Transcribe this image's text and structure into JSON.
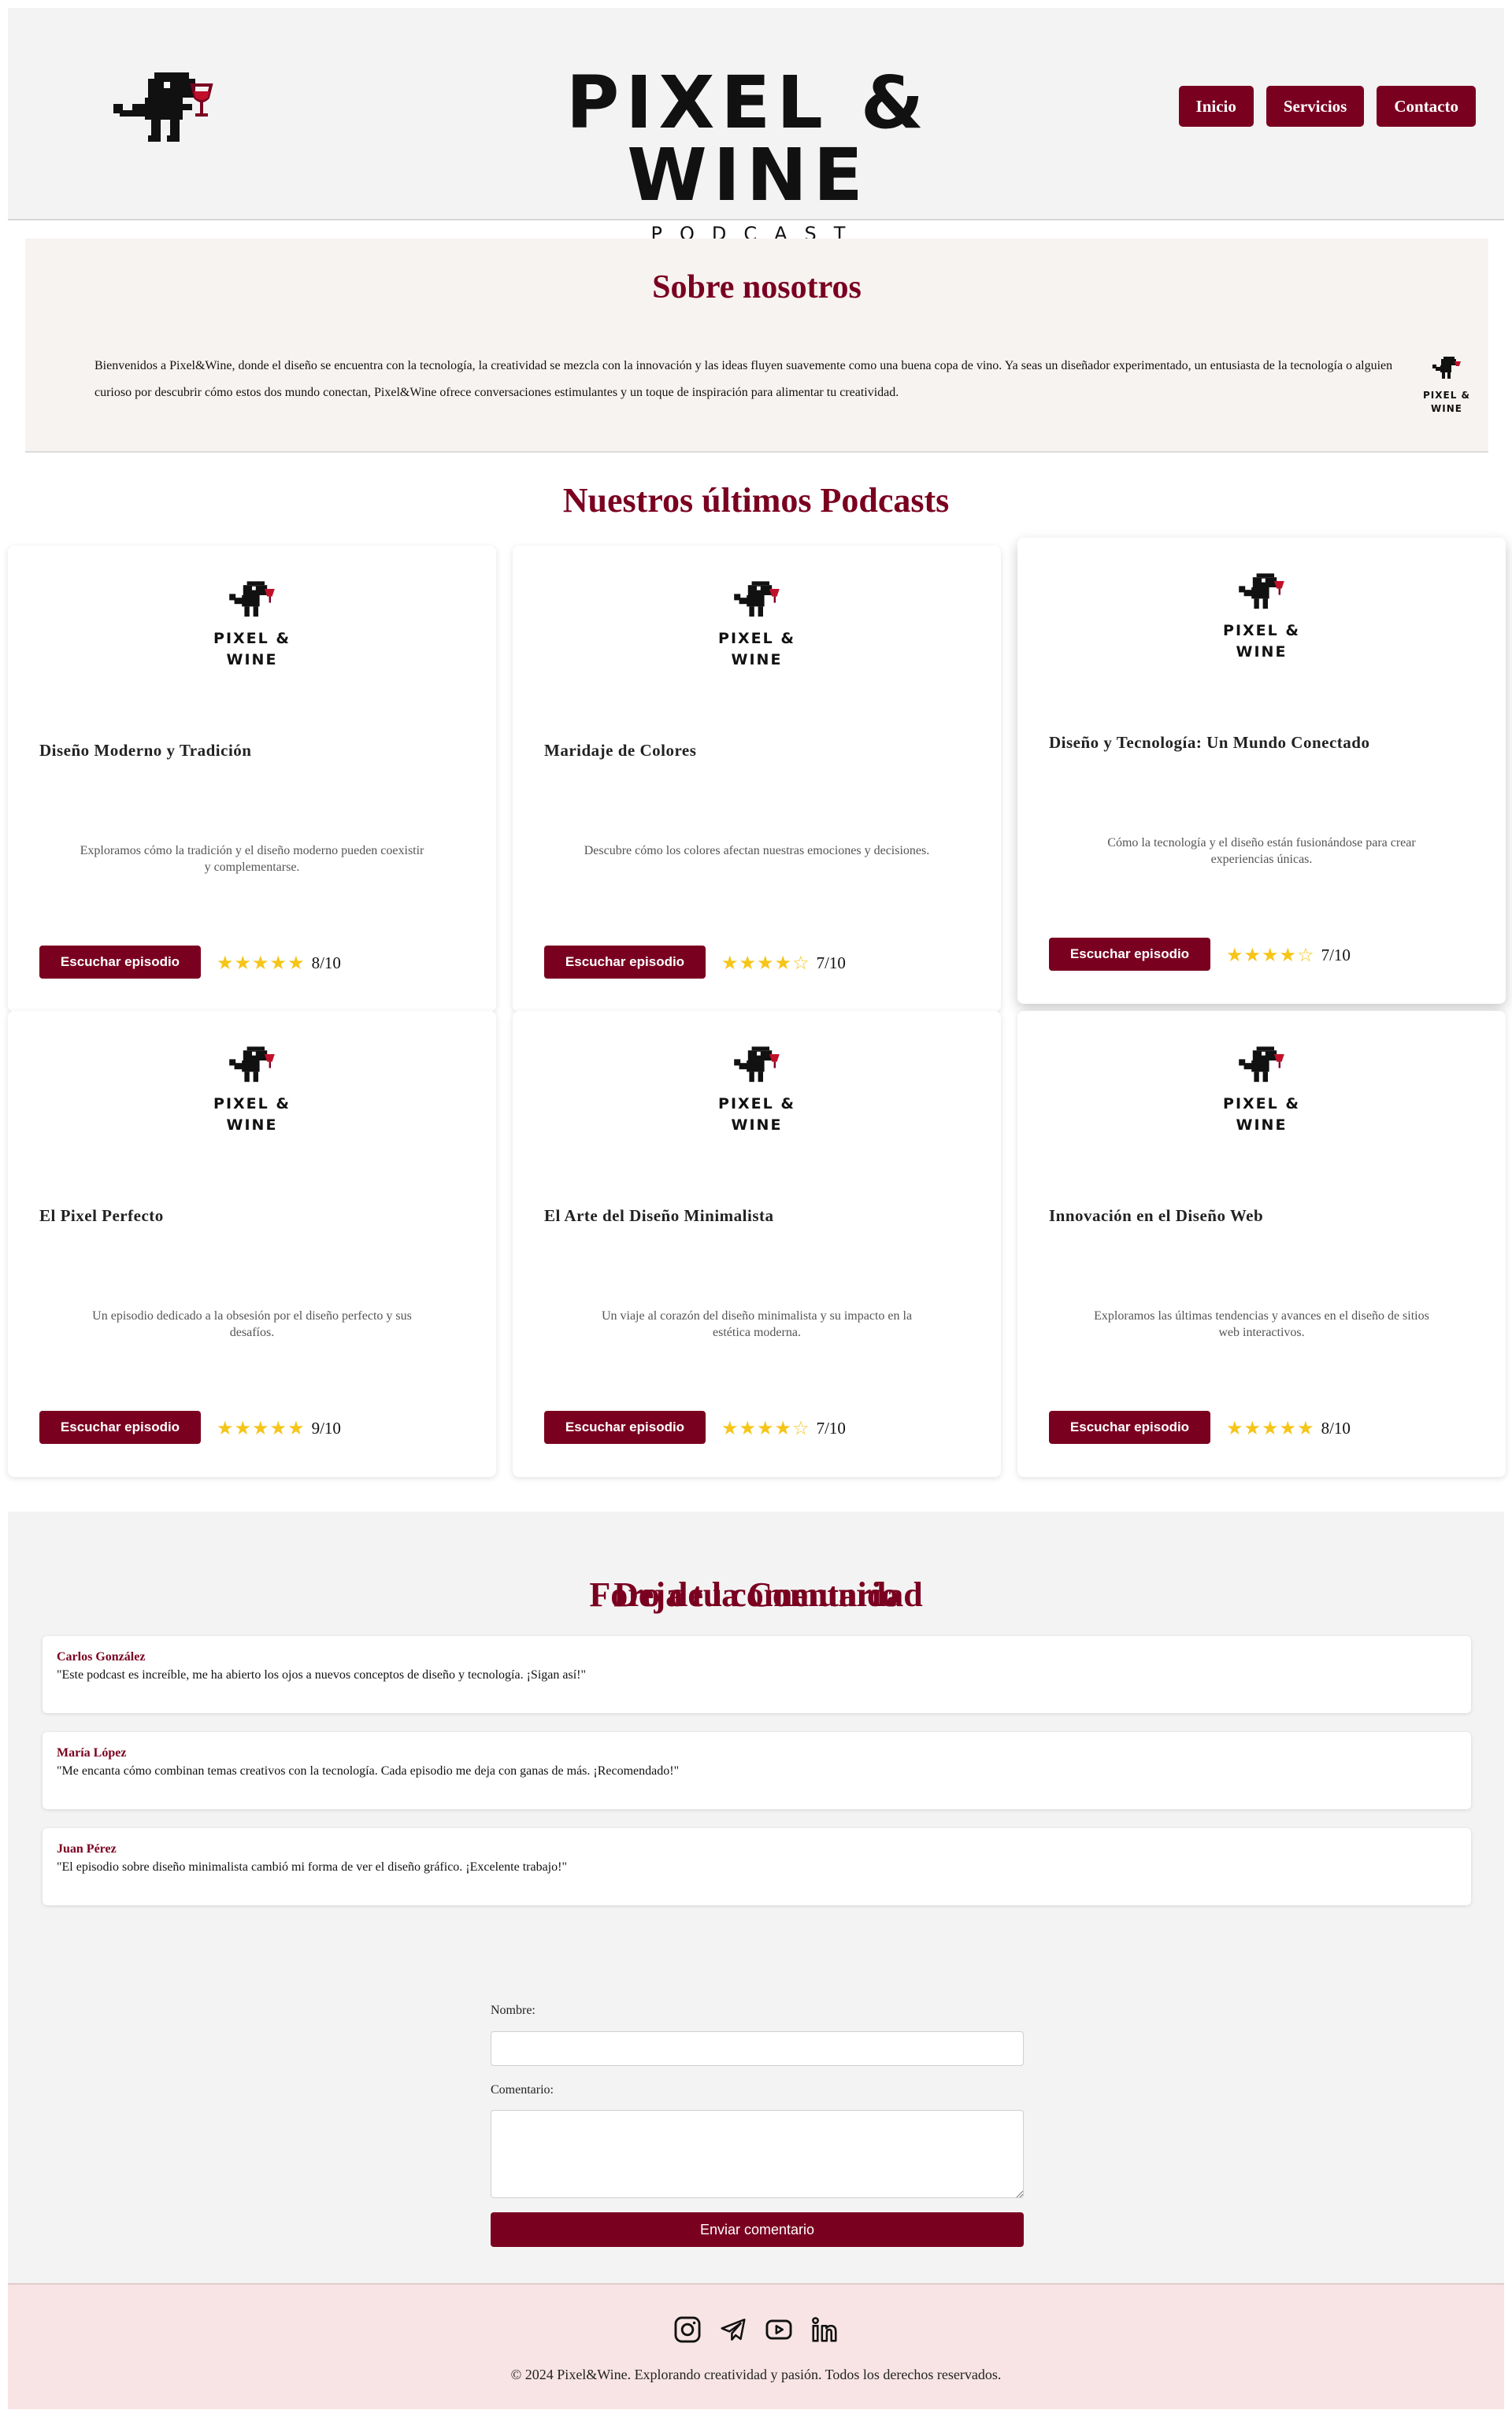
{
  "header": {
    "brand_name": "PIXEL & WINE",
    "brand_sub": "PODCAST",
    "nav": [
      "Inicio",
      "Servicios",
      "Contacto"
    ]
  },
  "about": {
    "title": "Sobre nosotros",
    "text": "Bienvenidos a Pixel&Wine, donde el diseño se encuentra con la tecnología, la creatividad se mezcla con la innovación y las ideas fluyen suavemente como una buena copa de vino. Ya seas un diseñador experimentado, un entusiasta de la tecnología o alguien curioso por descubrir cómo estos dos mundo conectan, Pixel&Wine ofrece conversaciones estimulantes y un toque de inspiración para alimentar tu creatividad."
  },
  "podcasts": {
    "title": "Nuestros últimos Podcasts",
    "logo_line1": "PIXEL &",
    "logo_line2": "WINE",
    "button_label": "Escuchar episodio",
    "items": [
      {
        "title": "Diseño Moderno y Tradición",
        "desc": "Exploramos cómo la tradición y el diseño moderno pueden coexistir y complementarse.",
        "stars": "★★★★★",
        "score": "8/10"
      },
      {
        "title": "Maridaje de Colores",
        "desc": "Descubre cómo los colores afectan nuestras emociones y decisiones.",
        "stars": "★★★★☆",
        "score": "7/10"
      },
      {
        "title": "Diseño y Tecnología: Un Mundo Conectado",
        "desc": "Cómo la tecnología y el diseño están fusionándose para crear experiencias únicas.",
        "stars": "★★★★☆",
        "score": "7/10"
      },
      {
        "title": "El Pixel Perfecto",
        "desc": "Un episodio dedicado a la obsesión por el diseño perfecto y sus desafíos.",
        "stars": "★★★★★",
        "score": "9/10"
      },
      {
        "title": "El Arte del Diseño Minimalista",
        "desc": "Un viaje al corazón del diseño minimalista y su impacto en la estética moderna.",
        "stars": "★★★★☆",
        "score": "7/10"
      },
      {
        "title": "Innovación en el Diseño Web",
        "desc": "Exploramos las últimas tendencias y avances en el diseño de sitios web interactivos.",
        "stars": "★★★★★",
        "score": "8/10"
      }
    ]
  },
  "forum": {
    "title": "Foro de la Comunidad",
    "comments": [
      {
        "author": "Carlos González",
        "text": "\"Este podcast es increíble, me ha abierto los ojos a nuevos conceptos de diseño y tecnología. ¡Sigan así!\""
      },
      {
        "author": "María López",
        "text": "\"Me encanta cómo combinan temas creativos con la tecnología. Cada episodio me deja con ganas de más. ¡Recomendado!\""
      },
      {
        "author": "Juan Pérez",
        "text": "\"El episodio sobre diseño minimalista cambió mi forma de ver el diseño gráfico. ¡Excelente trabajo!\""
      }
    ]
  },
  "form": {
    "title": "Deja tu comentario",
    "name_label": "Nombre:",
    "comment_label": "Comentario:",
    "name_value": "",
    "comment_value": "",
    "submit_label": "Enviar comentario"
  },
  "footer": {
    "icons": [
      "instagram-icon",
      "telegram-icon",
      "youtube-icon",
      "linkedin-icon"
    ],
    "copyright": "© 2024 Pixel&Wine. Explorando creatividad y pasión. Todos los derechos reservados."
  },
  "colors": {
    "accent": "#7a0020",
    "star": "#f5c518",
    "header_bg": "#f3f3f3",
    "about_bg": "#f7f3f0",
    "footer_bg": "#f8e4e4"
  }
}
